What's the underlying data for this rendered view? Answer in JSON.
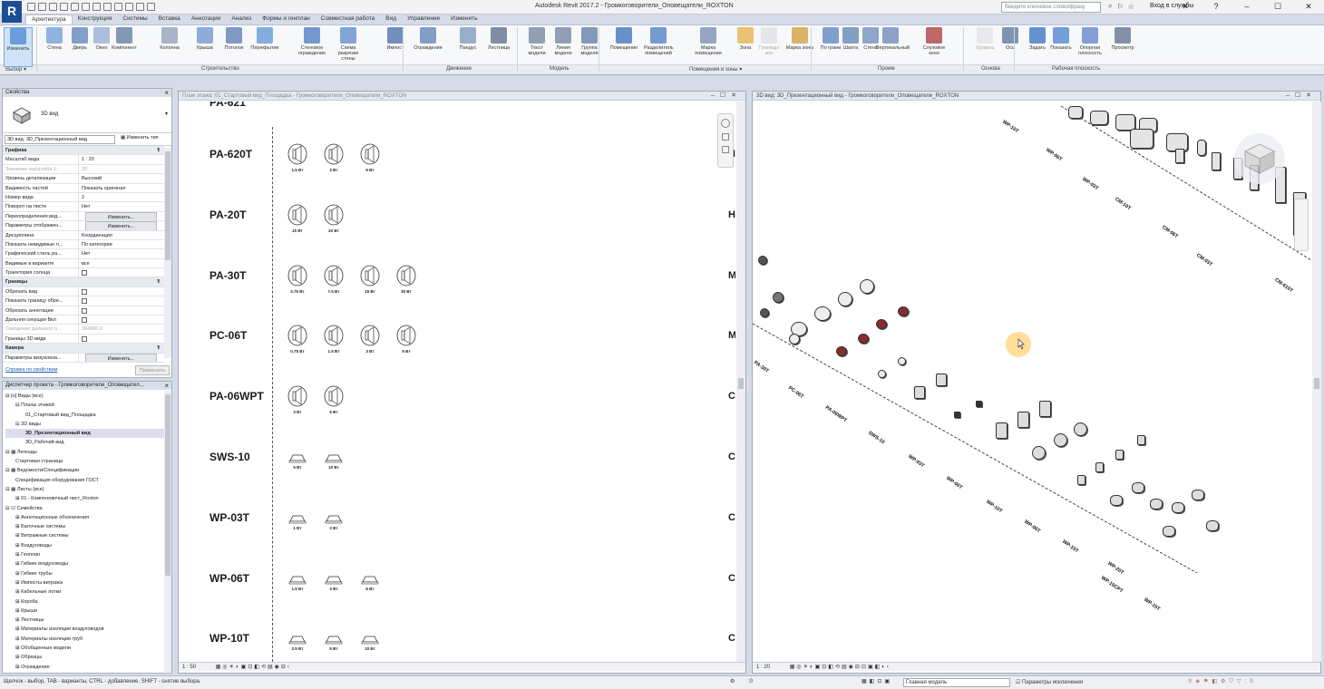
{
  "app": {
    "title": "Autodesk Revit 2017.2 -   Громкоговорители_Оповещатели_ROXTON",
    "logo": "R",
    "search_placeholder": "Введите ключевое слово/фразу",
    "sign_in": "Вход в службы"
  },
  "tabs": [
    "Архитектура",
    "Конструкция",
    "Системы",
    "Вставка",
    "Аннотации",
    "Анализ",
    "Формы и генплан",
    "Совместная работа",
    "Вид",
    "Управление",
    "Изменить"
  ],
  "ribbon": {
    "buttons": [
      "Изменить",
      "Стена",
      "Дверь",
      "Окно",
      "Компонент",
      "Колонна",
      "Крыша",
      "Потолок",
      "Перекрытие",
      "Стеновое ограждение",
      "Схема разрезки стены",
      "Импост",
      "Ограждение",
      "Пандус",
      "Лестница",
      "Текст модели",
      "Линия модели",
      "Группа модели",
      "Помещение",
      "Разделитель помещений",
      "Марка помещения",
      "Зона",
      "Границы зон",
      "Марка зоны",
      "По грани",
      "Шахта",
      "Стена",
      "Вертикальный",
      "Слуховое окно",
      "Уровень",
      "Ось",
      "Задать",
      "Показать",
      "Опорная плоскость",
      "Просмотр"
    ],
    "groups": [
      "Выбор ▾",
      "Строительство",
      "Движение",
      "Модель",
      "Помещения и зоны ▾",
      "Проем",
      "Основа",
      "Рабочая плоскость"
    ]
  },
  "properties": {
    "title": "Свойства",
    "type_name": "3D вид",
    "selector": "3D вид: 3D_Презентационный вид",
    "edit_type": "Изменить тип",
    "rows": [
      {
        "k": "Графика",
        "v": "",
        "group": true
      },
      {
        "k": "Масштаб вида",
        "v": "1 : 20"
      },
      {
        "k": "Значение масштаба   1:",
        "v": "20",
        "dim": true
      },
      {
        "k": "Уровень детализации",
        "v": "Высокий"
      },
      {
        "k": "Видимость частей",
        "v": "Показать оригинал"
      },
      {
        "k": "Номер вида",
        "v": "2"
      },
      {
        "k": "Поворот на листе",
        "v": "Нет"
      },
      {
        "k": "Переопределения вид...",
        "v": "Изменить...",
        "btn": true
      },
      {
        "k": "Параметры отображен...",
        "v": "Изменить...",
        "btn": true
      },
      {
        "k": "Дисциплина",
        "v": "Координация"
      },
      {
        "k": "Показать невидимые л...",
        "v": "По категории"
      },
      {
        "k": "Графический стиль ра...",
        "v": "Нет"
      },
      {
        "k": "Видимые в варианте",
        "v": "все"
      },
      {
        "k": "Траектория солнца",
        "v": "",
        "chk": true
      },
      {
        "k": "Границы",
        "v": "",
        "group": true
      },
      {
        "k": "Обрезать вид",
        "v": "",
        "chk": true
      },
      {
        "k": "Показать границу обре...",
        "v": "",
        "chk": true
      },
      {
        "k": "Обрезать аннотации",
        "v": "",
        "chk": true
      },
      {
        "k": "Дальняя секущая Вкл",
        "v": "",
        "chk": true
      },
      {
        "k": "Смещение дальнего п...",
        "v": "304800.0",
        "dim": true
      },
      {
        "k": "Границы 3D вида",
        "v": "",
        "chk": true
      },
      {
        "k": "Камера",
        "v": "",
        "group": true
      },
      {
        "k": "Параметры визуализа...",
        "v": "Изменить...",
        "btn": true
      }
    ],
    "help_link": "Справка по свойствам",
    "apply": "Применить"
  },
  "browser": {
    "title": "Диспетчер проекта - Громкоговорители_Оповещател...",
    "items": [
      {
        "t": "⊟ [o] Виды (все)",
        "d": 0
      },
      {
        "t": "⊟ Планы этажей",
        "d": 1
      },
      {
        "t": "01_Стартовый вид_Площадка",
        "d": 2
      },
      {
        "t": "⊟ 3D виды",
        "d": 1
      },
      {
        "t": "3D_Презентационный вид",
        "d": 2,
        "sel": true
      },
      {
        "t": "3D_Рабочий вид",
        "d": 2
      },
      {
        "t": "⊟ ▦ Легенды",
        "d": 0
      },
      {
        "t": "Стартовая страница",
        "d": 1
      },
      {
        "t": "⊟ ▦ Ведомости/Спецификации",
        "d": 0
      },
      {
        "t": "Спецификация оборудования ГОСТ",
        "d": 1
      },
      {
        "t": "⊟ ▦ Листы (все)",
        "d": 0
      },
      {
        "t": "⊞ 01 - Компоновочный лист_Roxton",
        "d": 1
      },
      {
        "t": "⊟ ☑ Семейства",
        "d": 0
      },
      {
        "t": "⊞ Аннотационные обозначения",
        "d": 1
      },
      {
        "t": "⊞ Балочные системы",
        "d": 1
      },
      {
        "t": "⊞ Витражные системы",
        "d": 1
      },
      {
        "t": "⊞ Воздуховоды",
        "d": 1
      },
      {
        "t": "⊞ Генплан",
        "d": 1
      },
      {
        "t": "⊞ Гибкие воздуховоды",
        "d": 1
      },
      {
        "t": "⊞ Гибкие трубы",
        "d": 1
      },
      {
        "t": "⊞ Импосты витража",
        "d": 1
      },
      {
        "t": "⊞ Кабельные лотки",
        "d": 1
      },
      {
        "t": "⊞ Короба",
        "d": 1
      },
      {
        "t": "⊞ Крыши",
        "d": 1
      },
      {
        "t": "⊞ Лестницы",
        "d": 1
      },
      {
        "t": "⊞ Материалы изоляции воздуховодов",
        "d": 1
      },
      {
        "t": "⊞ Материалы изоляции труб",
        "d": 1
      },
      {
        "t": "⊞ Обобщенные модели",
        "d": 1
      },
      {
        "t": "⊞ Образцы",
        "d": 1
      },
      {
        "t": "⊞ Ограждение",
        "d": 1
      }
    ]
  },
  "plan_view": {
    "title": "План этажа: 01_Стартовый вид_Площадка - Громкоговорители_Оповещатели_ROXTON",
    "scale": "1 : 50",
    "rows": [
      {
        "name": "PA-620T",
        "shape": "round",
        "labels": [
          "1.5 Вт",
          "3 Вт",
          "6 Вт"
        ],
        "right": "H"
      },
      {
        "name": "PA-20T",
        "shape": "round",
        "labels": [
          "10 Вт",
          "20 Вт"
        ],
        "right": "H"
      },
      {
        "name": "PA-30T",
        "shape": "round",
        "labels": [
          "3.75 Вт",
          "7.5 Вт",
          "15 Вт",
          "30 Вт"
        ],
        "right": "M"
      },
      {
        "name": "PC-06T",
        "shape": "round",
        "labels": [
          "0.75 Вт",
          "1.5 Вт",
          "3 Вт",
          "6 Вт"
        ],
        "right": "M"
      },
      {
        "name": "PA-06WPT",
        "shape": "round",
        "labels": [
          "3 Вт",
          "6 Вт"
        ],
        "right": "C"
      },
      {
        "name": "SWS-10",
        "shape": "flat",
        "labels": [
          "5 Вт",
          "10 Вт"
        ],
        "right": "C"
      },
      {
        "name": "WP-03T",
        "shape": "flat",
        "labels": [
          "1 Вт",
          "2 Вт"
        ],
        "right": "C"
      },
      {
        "name": "WP-06T",
        "shape": "flat",
        "labels": [
          "1.5 Вт",
          "3 Вт",
          "6 Вт"
        ],
        "right": "C"
      },
      {
        "name": "WP-10T",
        "shape": "flat",
        "labels": [
          "2.5 Вт",
          "5 Вт",
          "10 Вт"
        ],
        "right": "C"
      }
    ]
  },
  "view3d": {
    "title": "3D вид: 3D_Презентационный вид - Громкоговорители_Оповещатели_ROXTON",
    "scale": "1 : 20",
    "labels": [
      "WP-10T",
      "WP-06T",
      "WP-03T",
      "CM-10T",
      "CM-06T",
      "CM-03T",
      "CM-610T",
      "PA-30T",
      "PC-06T",
      "PA-06WPT",
      "SWS-10",
      "WP-03T",
      "WP-06T",
      "WP-10T",
      "WP-06T",
      "WP-15T",
      "WP-20T",
      "WP-15CPT",
      "WP-15T"
    ]
  },
  "status": {
    "hint": "Щелчок - выбор, TAB - варианты, CTRL - добавление, SHIFT - снятие выбора.",
    "model": "Главная модель",
    "exclusions": "Параметры исключения",
    "zero": ":0"
  }
}
